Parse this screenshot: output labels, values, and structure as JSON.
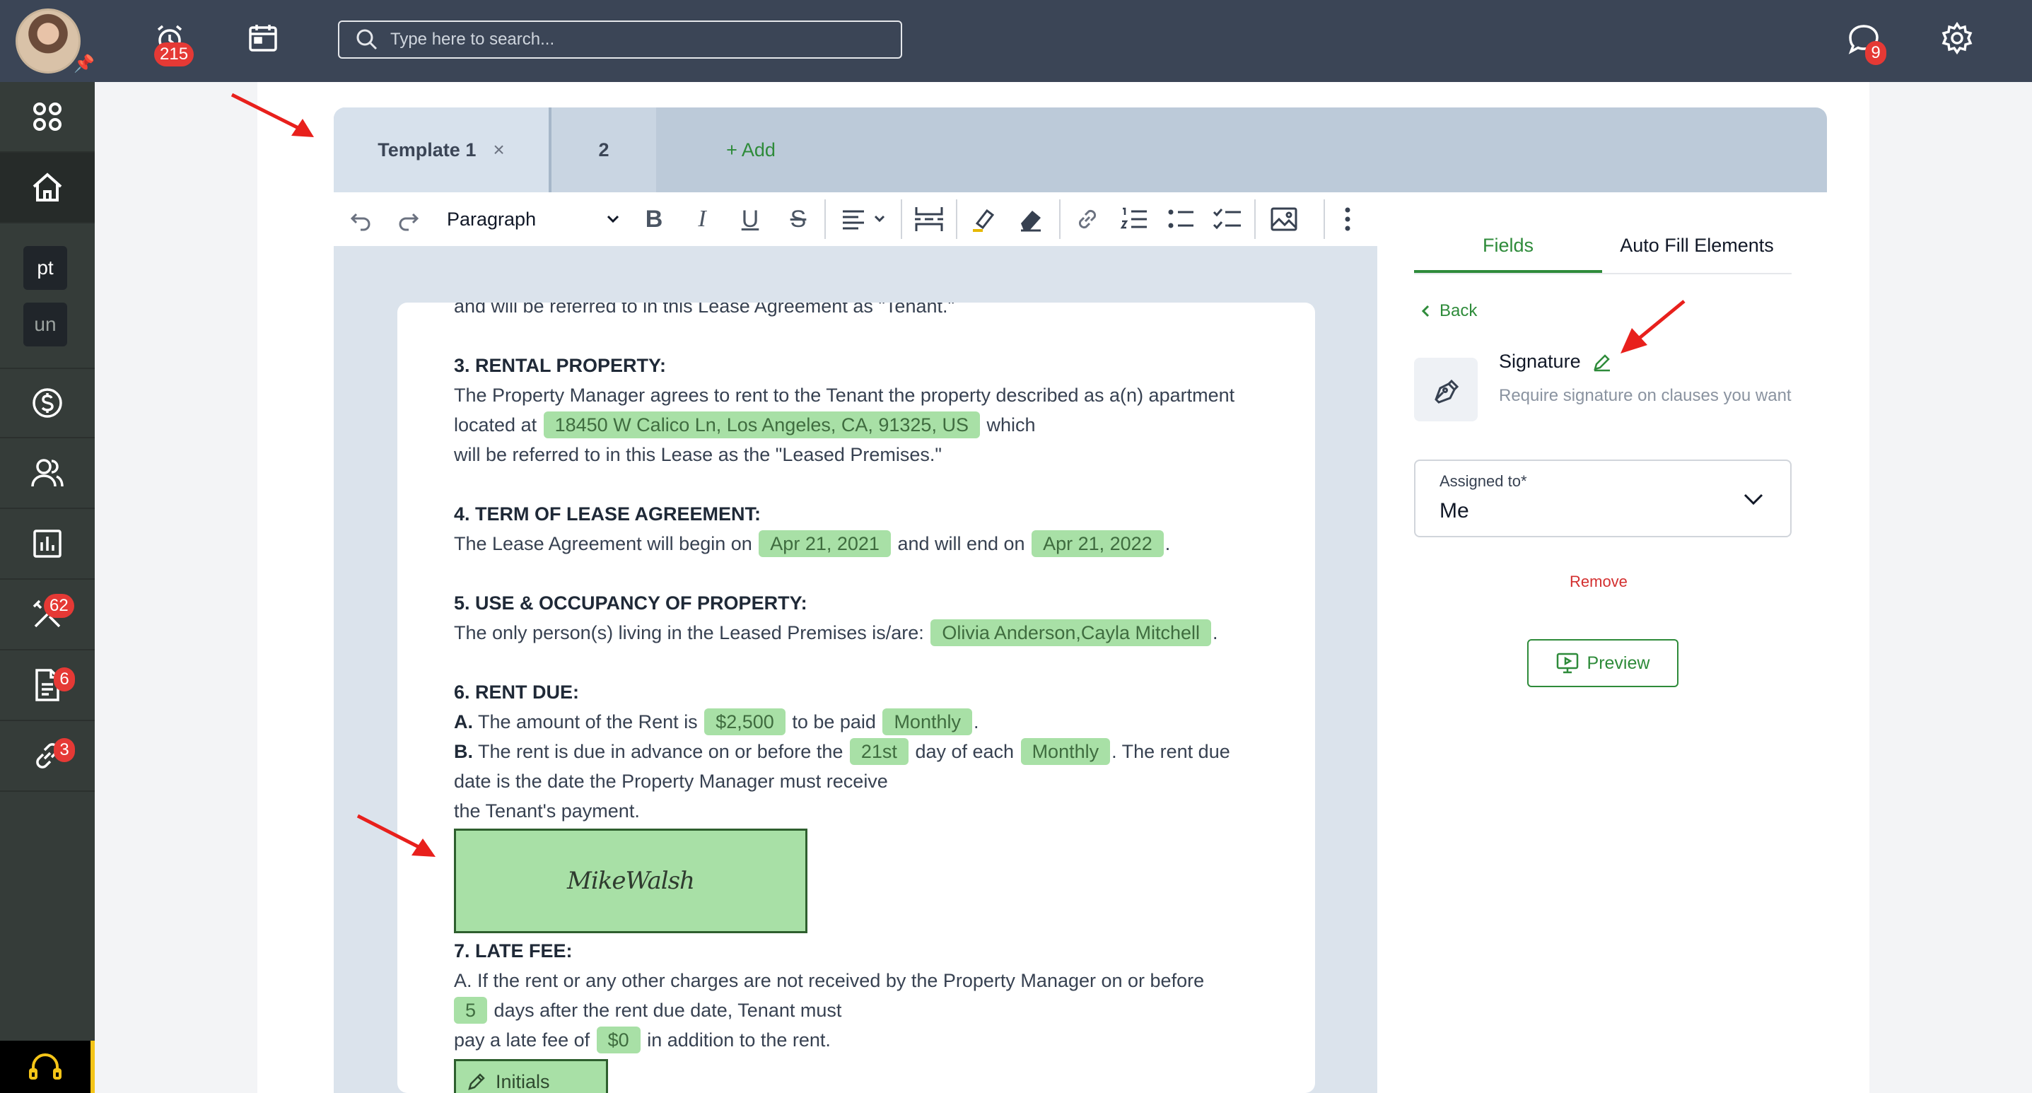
{
  "topbar": {
    "search_placeholder": "Type here to search...",
    "alarm_badge": "215",
    "chat_badge": "9"
  },
  "sidebar": {
    "tag_pt": "pt",
    "tag_un": "un",
    "tools_badge": "62",
    "documents_badge": "6",
    "links_badge": "3"
  },
  "tabs": {
    "template1": "Template 1",
    "close": "×",
    "tab2": "2",
    "add": "+ Add"
  },
  "toolbar": {
    "paragraph": "Paragraph"
  },
  "document": {
    "top_cut": "and will be referred to in this Lease Agreement as \"Tenant.\"",
    "s3_heading": "3. RENTAL PROPERTY:",
    "s3_line1": "The Property Manager agrees to rent to the Tenant the property described as a(n) apartment",
    "s3_line2a": "located at",
    "s3_address": "18450 W Calico Ln, Los Angeles, CA, 91325, US",
    "s3_line2b": "which",
    "s3_line3": "will be referred to in this Lease as the \"Leased Premises.\"",
    "s4_heading": "4. TERM OF LEASE AGREEMENT:",
    "s4_a": "The Lease Agreement will begin on",
    "s4_start": "Apr 21, 2021",
    "s4_b": "and will end on",
    "s4_end": "Apr 21, 2022",
    "s4_c": ".",
    "s5_heading": "5. USE & OCCUPANCY OF PROPERTY:",
    "s5_a": "The only person(s) living in the Leased Premises is/are:",
    "s5_people": "Olivia Anderson,Cayla Mitchell",
    "s5_b": ".",
    "s6_heading": "6. RENT DUE:",
    "s6_a_label": "A.",
    "s6_a1": "The amount of the Rent is",
    "s6_amount": "$2,500",
    "s6_a2": "to be paid",
    "s6_freq1": "Monthly",
    "s6_a3": ".",
    "s6_b_label": "B.",
    "s6_b1": "The rent is due in advance on or before the",
    "s6_day": "21st",
    "s6_b2": "day of each",
    "s6_freq2": "Monthly",
    "s6_b3": ". The rent due",
    "s6_b4": "date is the date the Property Manager must receive",
    "s6_b5": "the Tenant's payment.",
    "signature_text": "MikeWalsh",
    "s7_heading": "7. LATE FEE:",
    "s7_a1": "A. If the rent or any other charges are not received by the Property Manager on or before",
    "s7_days": "5",
    "s7_a2": "days after the rent due date, Tenant must",
    "s7_a3": "pay a late fee of",
    "s7_fee": "$0",
    "s7_a4": "in addition to the rent.",
    "initials_label": "Initials"
  },
  "panel": {
    "tab_fields": "Fields",
    "tab_autofill": "Auto Fill Elements",
    "back": "Back",
    "field_title": "Signature",
    "field_desc": "Require signature on clauses you want",
    "assigned_label": "Assigned to*",
    "assigned_value": "Me",
    "remove": "Remove",
    "preview": "Preview"
  },
  "colors": {
    "accent_green": "#2e8b3a",
    "chip_green": "#a8e0a6",
    "topbar": "#3b4556",
    "sidebar": "#353c39",
    "badge_red": "#e53935",
    "annotation_arrow": "#e8201c"
  }
}
